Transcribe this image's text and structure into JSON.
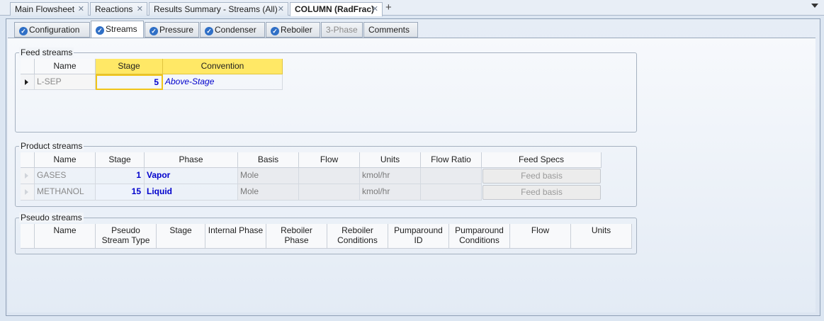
{
  "doc_tabs": [
    {
      "label": "Main Flowsheet"
    },
    {
      "label": "Reactions"
    },
    {
      "label": "Results Summary - Streams (All)"
    },
    {
      "label": "COLUMN (RadFrac)"
    }
  ],
  "sub_tabs": [
    {
      "label": "Configuration"
    },
    {
      "label": "Streams"
    },
    {
      "label": "Pressure"
    },
    {
      "label": "Condenser"
    },
    {
      "label": "Reboiler"
    },
    {
      "label": "3-Phase"
    },
    {
      "label": "Comments"
    }
  ],
  "feed": {
    "title": "Feed streams",
    "columns": [
      "Name",
      "Stage",
      "Convention"
    ],
    "rows": [
      {
        "name": "L-SEP",
        "stage": "5",
        "convention": "Above-Stage"
      }
    ]
  },
  "product": {
    "title": "Product streams",
    "columns": [
      "Name",
      "Stage",
      "Phase",
      "Basis",
      "Flow",
      "Units",
      "Flow Ratio",
      "Feed Specs"
    ],
    "rows": [
      {
        "name": "GASES",
        "stage": "1",
        "phase": "Vapor",
        "basis": "Mole",
        "flow": "",
        "units": "kmol/hr",
        "flow_ratio": "",
        "feed_specs": "Feed basis"
      },
      {
        "name": "METHANOL",
        "stage": "15",
        "phase": "Liquid",
        "basis": "Mole",
        "flow": "",
        "units": "kmol/hr",
        "flow_ratio": "",
        "feed_specs": "Feed basis"
      }
    ]
  },
  "pseudo": {
    "title": "Pseudo streams",
    "columns": [
      "Name",
      "Pseudo Stream Type",
      "Stage",
      "Internal Phase",
      "Reboiler Phase",
      "Reboiler Conditions",
      "Pumparound ID",
      "Pumparound Conditions",
      "Flow",
      "Units"
    ]
  },
  "icons": {
    "tab_close": "close-icon",
    "add_tab": "plus-icon",
    "menu": "chevron-down-icon",
    "tab_status": "check-circle-icon"
  },
  "colors": {
    "accent_highlight": "#ffe866",
    "value_blue": "#0000cc",
    "status_check": "#2f6fc6"
  }
}
